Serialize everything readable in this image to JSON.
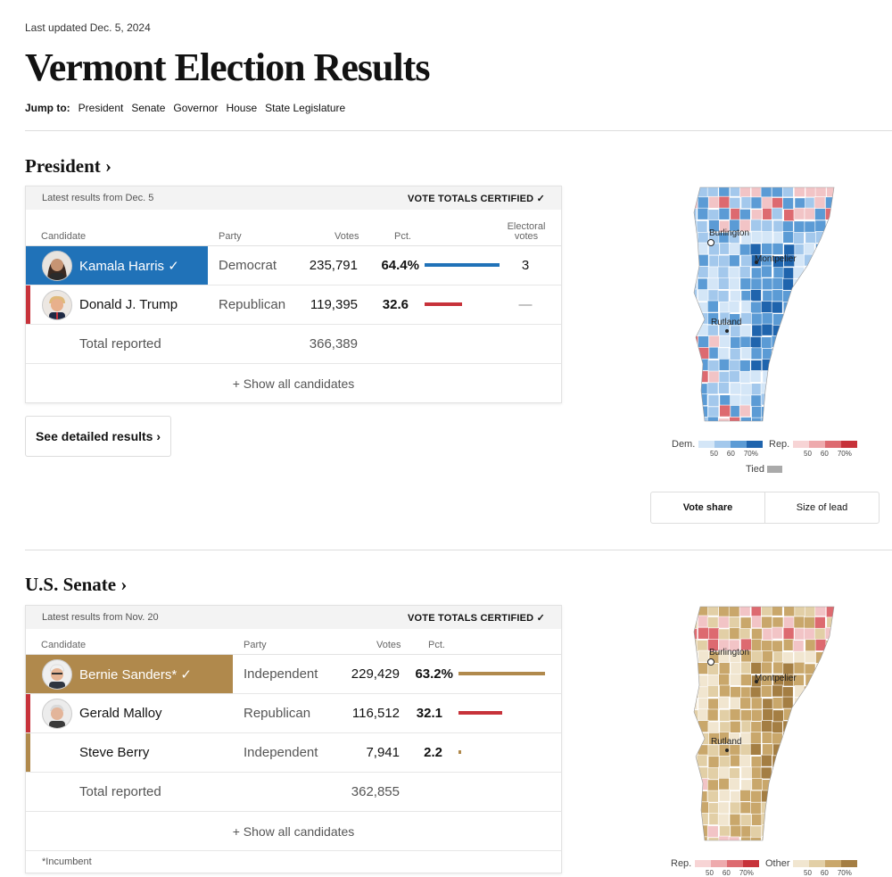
{
  "header": {
    "updated": "Last updated Dec. 5, 2024",
    "title": "Vermont Election Results",
    "jump_label": "Jump to:",
    "jump_links": [
      "President",
      "Senate",
      "Governor",
      "House",
      "State Legislature"
    ]
  },
  "colors": {
    "dem": "#2072b8",
    "rep": "#c7323a",
    "ind": "#b0894c",
    "dem_light": "#c6dcf2",
    "rep_light": "#f2c4c6",
    "ind_light": "#e9d9b8"
  },
  "president": {
    "section_title": "President ›",
    "latest": "Latest results from Dec. 5",
    "certified": "VOTE TOTALS CERTIFIED ✓",
    "columns": {
      "candidate": "Candidate",
      "party": "Party",
      "votes": "Votes",
      "pct": "Pct.",
      "ev_line1": "Electoral",
      "ev_line2": "votes"
    },
    "candidates": [
      {
        "name": "Kamala Harris ✓",
        "party": "Democrat",
        "votes": "235,791",
        "pct": "64.4%",
        "pct_value": 64.4,
        "ev": "3"
      },
      {
        "name": "Donald J. Trump",
        "party": "Republican",
        "votes": "119,395",
        "pct": "32.6",
        "pct_value": 32.6,
        "ev": "—"
      }
    ],
    "total_label": "Total reported",
    "total_votes": "366,389",
    "show_all": "+ Show all candidates",
    "detailed": "See detailed results ›",
    "map": {
      "cities": [
        "Burlington",
        "Montpelier",
        "Rutland"
      ],
      "legend_dem": "Dem.",
      "legend_rep": "Rep.",
      "legend_ticks": [
        "50",
        "60",
        "70%"
      ],
      "legend_tied": "Tied",
      "toggle": [
        "Vote share",
        "Size of lead"
      ]
    }
  },
  "senate": {
    "section_title": "U.S. Senate ›",
    "latest": "Latest results from Nov. 20",
    "certified": "VOTE TOTALS CERTIFIED ✓",
    "columns": {
      "candidate": "Candidate",
      "party": "Party",
      "votes": "Votes",
      "pct": "Pct."
    },
    "candidates": [
      {
        "name": "Bernie Sanders* ✓",
        "party": "Independent",
        "votes": "229,429",
        "pct": "63.2%",
        "pct_value": 63.2
      },
      {
        "name": "Gerald Malloy",
        "party": "Republican",
        "votes": "116,512",
        "pct": "32.1",
        "pct_value": 32.1
      },
      {
        "name": "Steve Berry",
        "party": "Independent",
        "votes": "7,941",
        "pct": "2.2",
        "pct_value": 2.2
      }
    ],
    "total_label": "Total reported",
    "total_votes": "362,855",
    "show_all": "+ Show all candidates",
    "footnote": "*Incumbent",
    "map": {
      "cities": [
        "Burlington",
        "Montpelier",
        "Rutland"
      ],
      "legend_rep": "Rep.",
      "legend_other": "Other",
      "legend_ticks": [
        "50",
        "60",
        "70%"
      ]
    }
  }
}
